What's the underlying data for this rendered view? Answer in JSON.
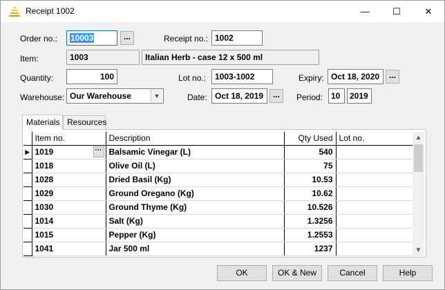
{
  "window": {
    "title": "Receipt 1002",
    "minimize": "—",
    "maximize": "☐",
    "close": "✕"
  },
  "form": {
    "order_no_label": "Order no.:",
    "order_no": "10003",
    "receipt_no_label": "Receipt no.:",
    "receipt_no": "1002",
    "item_label": "Item:",
    "item_no": "1003",
    "item_desc": "Italian Herb - case 12 x 500 ml",
    "quantity_label": "Quantity:",
    "quantity": "100",
    "lot_no_label": "Lot no.:",
    "lot_no": "1003-1002",
    "expiry_label": "Expiry:",
    "expiry": "Oct 18, 2020",
    "warehouse_label": "Warehouse:",
    "warehouse": "Our Warehouse",
    "date_label": "Date:",
    "date": "Oct 18, 2019",
    "period_label": "Period:",
    "period_no": "10",
    "period_year": "2019",
    "ellipsis": "..."
  },
  "tabs": [
    "Materials",
    "Resources"
  ],
  "grid": {
    "columns": [
      "Item no.",
      "Description",
      "Qty Used",
      "Lot no."
    ],
    "rows": [
      {
        "item": "1019",
        "desc": "Balsamic Vinegar (L)",
        "qty": "540",
        "lot": ""
      },
      {
        "item": "1018",
        "desc": "Olive Oil (L)",
        "qty": "75",
        "lot": ""
      },
      {
        "item": "1028",
        "desc": "Dried Basil (Kg)",
        "qty": "10.53",
        "lot": ""
      },
      {
        "item": "1029",
        "desc": "Ground Oregano (Kg)",
        "qty": "10.62",
        "lot": ""
      },
      {
        "item": "1030",
        "desc": "Ground Thyme (Kg)",
        "qty": "10.526",
        "lot": ""
      },
      {
        "item": "1014",
        "desc": "Salt (Kg)",
        "qty": "1.3256",
        "lot": ""
      },
      {
        "item": "1015",
        "desc": "Pepper (Kg)",
        "qty": "1.2553",
        "lot": ""
      },
      {
        "item": "1041",
        "desc": "Jar 500 ml",
        "qty": "1237",
        "lot": ""
      }
    ],
    "current_row_marker": "▶",
    "cell_ellipsis": "···"
  },
  "buttons": {
    "ok": "OK",
    "ok_new": "OK & New",
    "cancel": "Cancel",
    "help": "Help"
  },
  "icons": {
    "app": "scale-icon",
    "combo": "chevron-down-icon",
    "scroll_up": "▲",
    "scroll_down": "▼"
  }
}
